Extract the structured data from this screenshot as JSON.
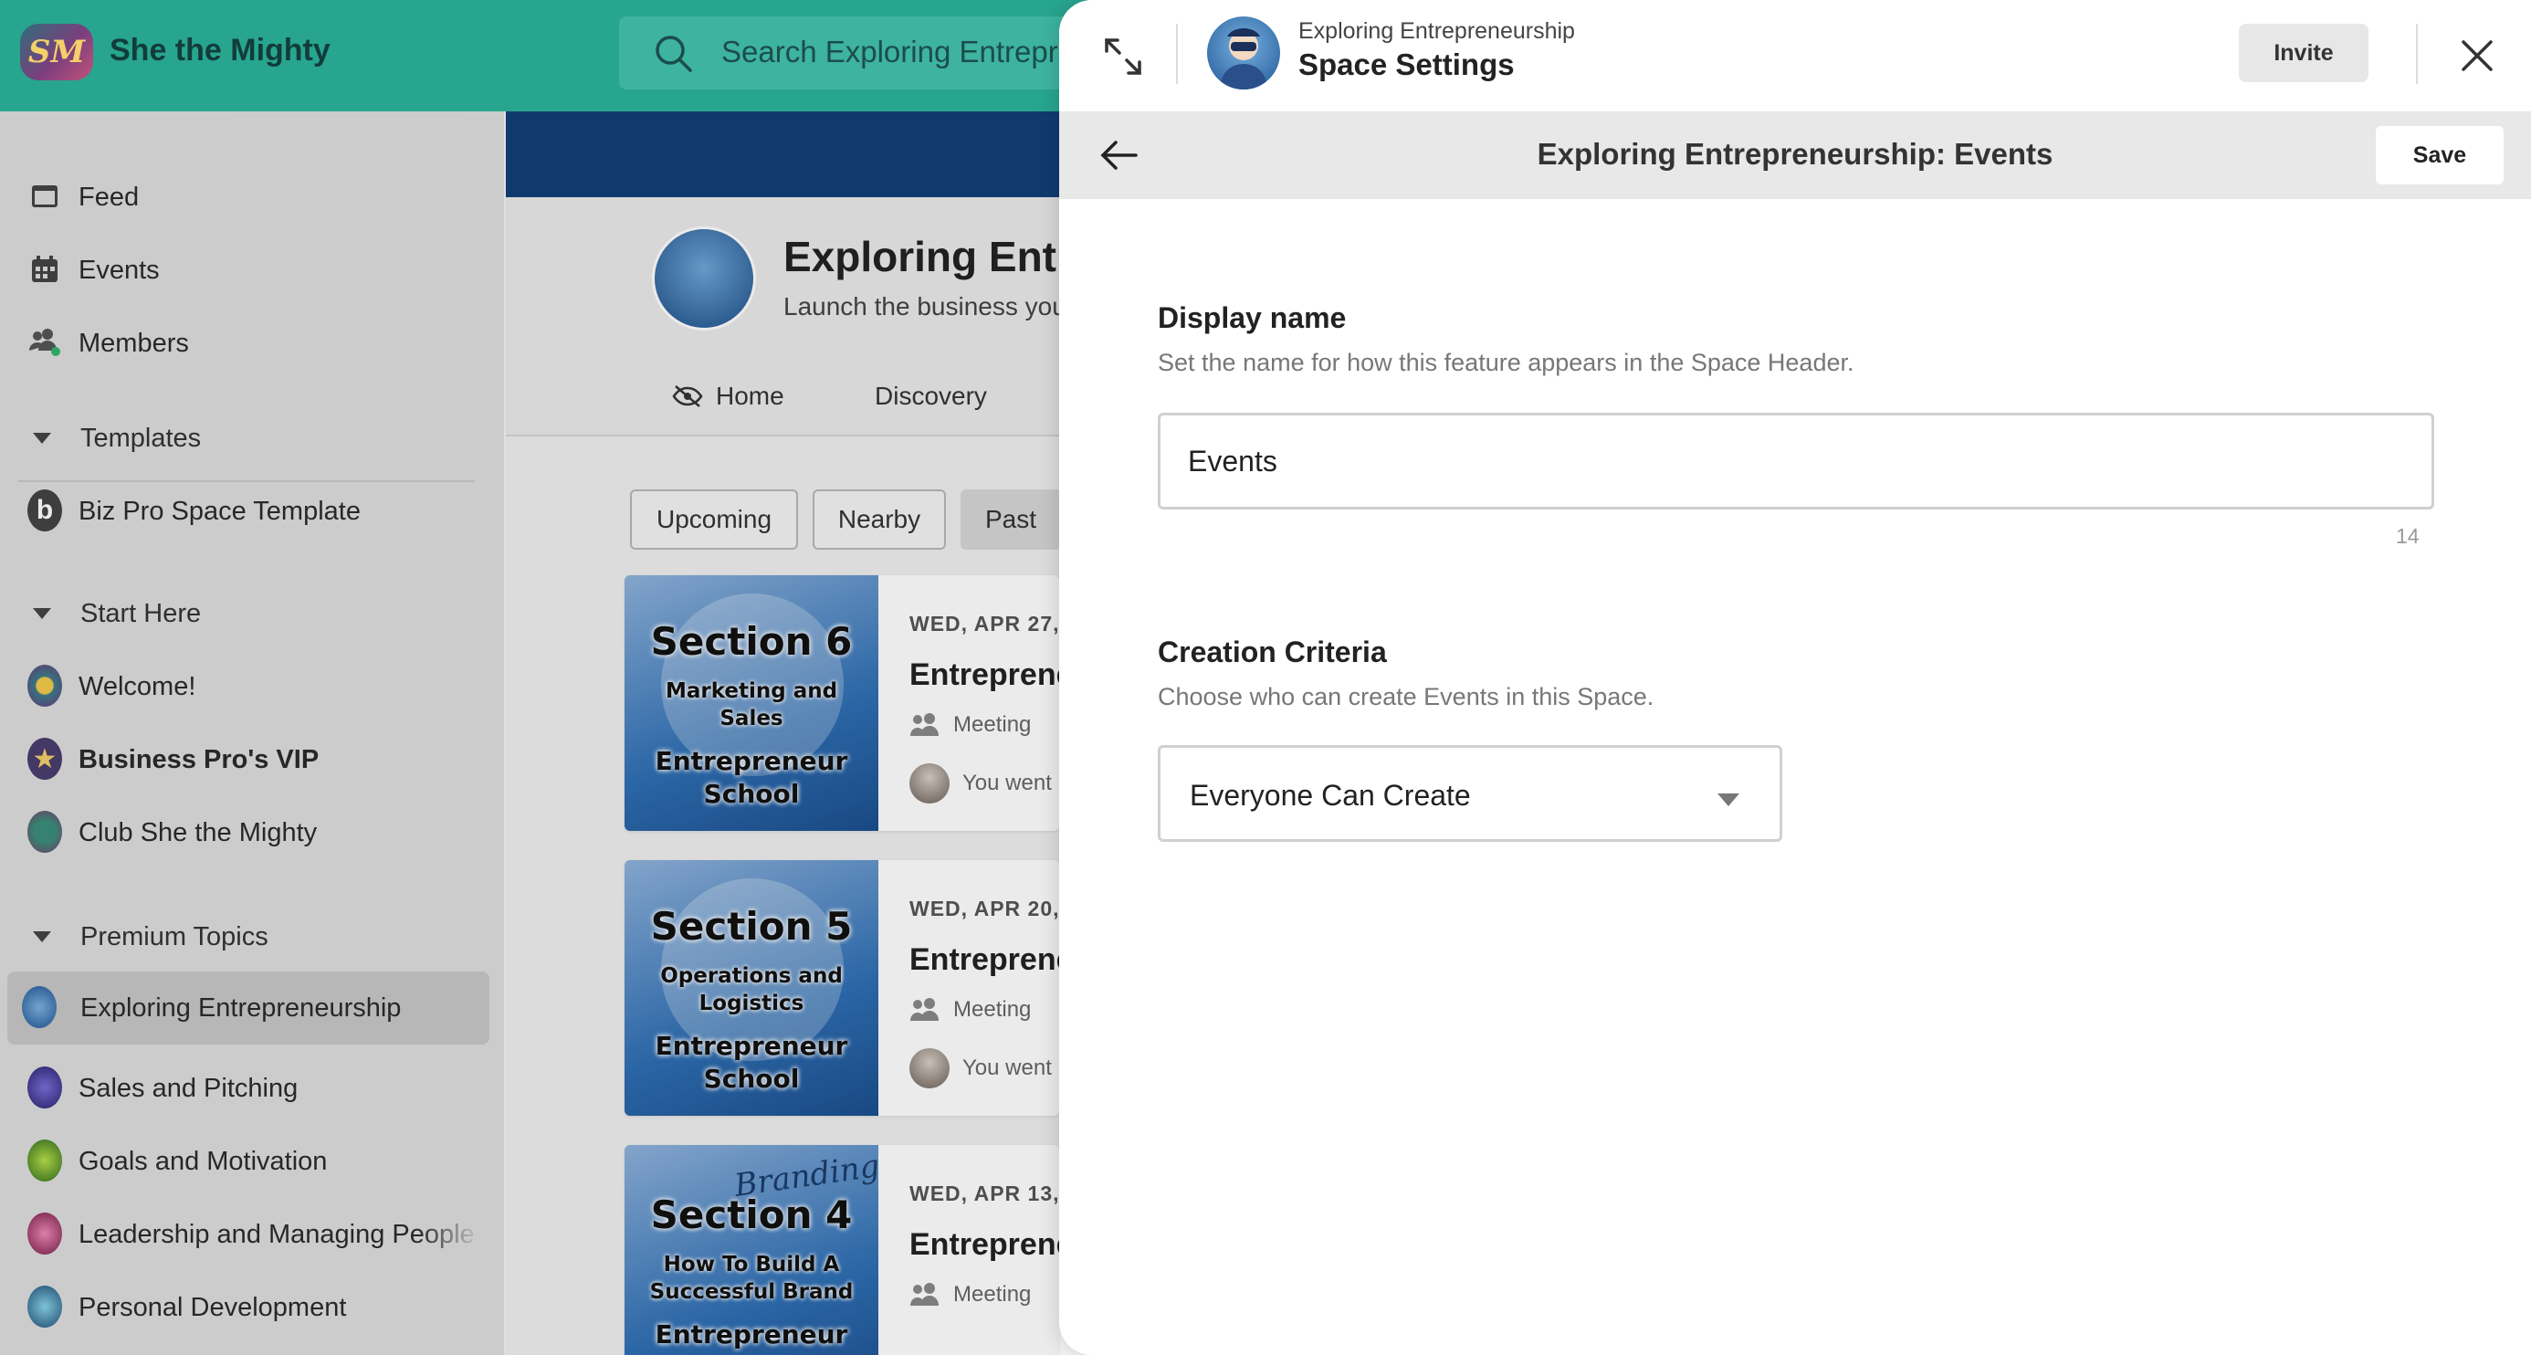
{
  "topbar": {
    "logo_text": "SM",
    "brand_name": "She the Mighty",
    "search_placeholder": "Search Exploring Entrepreneurship"
  },
  "sidebar": {
    "nav": [
      {
        "label": "Feed",
        "icon": "feed-icon"
      },
      {
        "label": "Events",
        "icon": "calendar-icon"
      },
      {
        "label": "Members",
        "icon": "members-icon"
      }
    ],
    "sections": [
      {
        "label": "Templates",
        "items": [
          {
            "label": "Biz Pro Space Template",
            "icon": "b-logo-icon"
          }
        ]
      },
      {
        "label": "Start Here",
        "items": [
          {
            "label": "Welcome!",
            "icon": "welcome-icon"
          },
          {
            "label": "Business Pro's VIP",
            "icon": "star-icon"
          },
          {
            "label": "Club She the Mighty",
            "icon": "globe-icon"
          }
        ]
      },
      {
        "label": "Premium Topics",
        "items": [
          {
            "label": "Exploring Entrepreneurship",
            "icon": "space-avatar-icon"
          },
          {
            "label": "Sales and Pitching",
            "icon": "space-avatar-icon"
          },
          {
            "label": "Goals and Motivation",
            "icon": "space-avatar-icon"
          },
          {
            "label": "Leadership and Managing People",
            "icon": "space-avatar-icon"
          },
          {
            "label": "Personal Development",
            "icon": "space-avatar-icon"
          }
        ]
      }
    ]
  },
  "space": {
    "title": "Exploring Entrepreneurship",
    "subtitle": "Launch the business you've been dreaming of",
    "tabs": [
      "Home",
      "Discovery"
    ],
    "filters": [
      "Upcoming",
      "Nearby",
      "Past"
    ],
    "active_filter": "Past"
  },
  "events": [
    {
      "thumb_section": "Section 6",
      "thumb_sub": "Marketing and Sales",
      "thumb_school": "Entrepreneur School",
      "date": "WED, APR 27,",
      "title": "Entrepreneur",
      "type": "Meeting",
      "attendance": "You went"
    },
    {
      "thumb_section": "Section 5",
      "thumb_sub": "Operations and Logistics",
      "thumb_school": "Entrepreneur School",
      "date": "WED, APR 20,",
      "title": "Entrepreneur",
      "type": "Meeting",
      "attendance": "You went"
    },
    {
      "thumb_section": "Section 4",
      "thumb_sub": "How To Build A Successful Brand",
      "thumb_school": "Entrepreneur",
      "thumb_overlay": "Branding",
      "date": "WED, APR 13,",
      "title": "Entrepreneur",
      "type": "Meeting",
      "attendance": "You went"
    }
  ],
  "panel": {
    "breadcrumb": "Exploring Entrepreneurship",
    "title": "Space Settings",
    "invite_label": "Invite",
    "subheader_title": "Exploring Entrepreneurship: Events",
    "save_label": "Save",
    "display_name": {
      "label": "Display name",
      "help": "Set the name for how this feature appears in the Space Header.",
      "value": "Events",
      "char_count": "14"
    },
    "creation_criteria": {
      "label": "Creation Criteria",
      "help": "Choose who can create Events in this Space.",
      "selected": "Everyone Can Create"
    }
  },
  "colors": {
    "topbar": "#27a58f",
    "banner": "#123f78",
    "sidebar": "#dedede",
    "panel": "#ffffff"
  }
}
